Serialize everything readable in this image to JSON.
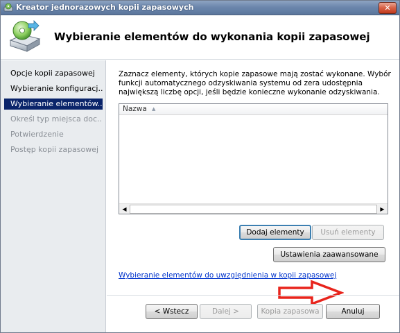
{
  "window": {
    "title": "Kreator jednorazowych kopii zapasowych",
    "close_symbol": "✕"
  },
  "header": {
    "title": "Wybieranie elementów do wykonania kopii zapasowej",
    "icon": "backup-disk-icon"
  },
  "sidebar": {
    "items": [
      {
        "label": "Opcje kopii zapasowej",
        "state": "normal"
      },
      {
        "label": "Wybieranie konfiguracj...",
        "state": "normal"
      },
      {
        "label": "Wybieranie elementów...",
        "state": "active"
      },
      {
        "label": "Określ typ miejsca doc...",
        "state": "disabled"
      },
      {
        "label": "Potwierdzenie",
        "state": "disabled"
      },
      {
        "label": "Postęp kopii zapasowej",
        "state": "disabled"
      }
    ]
  },
  "main": {
    "description": "Zaznacz elementy, których kopie zapasowe mają zostać wykonane. Wybór funkcji automatycznego odzyskiwania systemu od zera udostępnia największą liczbę opcji, jeśli będzie konieczne wykonanie odzyskiwania.",
    "list": {
      "column_header": "Nazwa",
      "sort_indicator": "▲",
      "rows": []
    },
    "add_button": "Dodaj elementy",
    "remove_button": "Usuń elementy",
    "advanced_button": "Ustawienia zaawansowane",
    "help_link": "Wybieranie elementów do uwzględnienia w kopii zapasowej"
  },
  "footer": {
    "back": "< Wstecz",
    "next": "Dalej >",
    "backup": "Kopia zapasowa",
    "cancel": "Anuluj"
  },
  "colors": {
    "selection": "#0a246a",
    "annotation_arrow": "#e8241c",
    "link": "#0033cc"
  }
}
